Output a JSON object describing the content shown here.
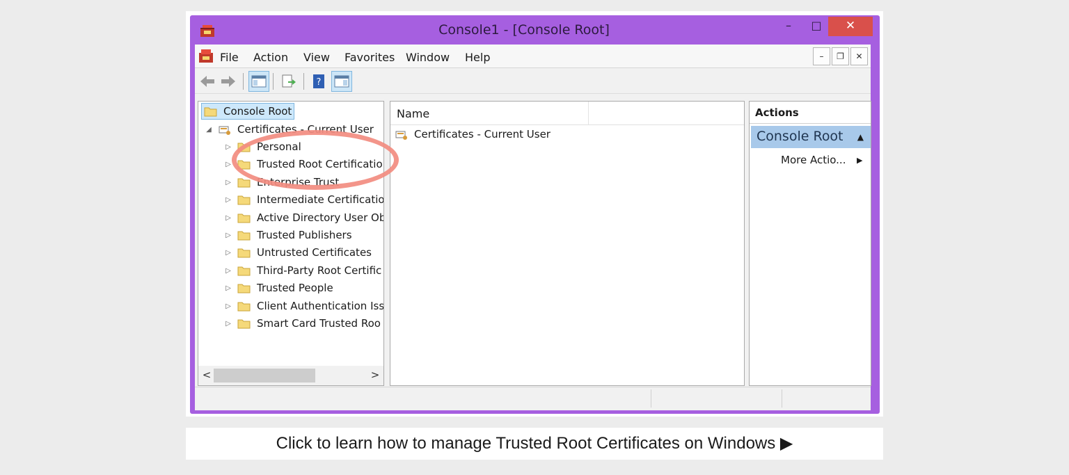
{
  "window": {
    "title": "Console1 - [Console Root]",
    "minimize_glyph": "–",
    "maximize_glyph": "□",
    "close_glyph": "✕",
    "titlebar_color": "#a65fe0",
    "close_color": "#d9504b",
    "app_icon": "mmc-toolbox-icon"
  },
  "menubar": {
    "items": [
      "File",
      "Action",
      "View",
      "Favorites",
      "Window",
      "Help"
    ],
    "mdi": [
      "–",
      "❐",
      "✕"
    ]
  },
  "toolbar": {
    "buttons": [
      "back-arrow-icon",
      "forward-arrow-icon",
      "show-hide-console-tree-icon",
      "export-list-icon",
      "help-icon",
      "show-hide-action-pane-icon"
    ]
  },
  "tree": {
    "root": "Console Root",
    "snapin": "Certificates - Current User",
    "children": [
      "Personal",
      "Trusted Root Certificatio",
      "Enterprise Trust",
      "Intermediate Certificatio",
      "Active Directory User Ob",
      "Trusted Publishers",
      "Untrusted Certificates",
      "Third-Party Root Certific",
      "Trusted People",
      "Client Authentication Iss",
      "Smart Card Trusted Roo"
    ],
    "scroll_left": "<",
    "scroll_right": ">"
  },
  "list": {
    "column_name": "Name",
    "rows": [
      "Certificates - Current User"
    ]
  },
  "actions": {
    "header": "Actions",
    "section": "Console Root",
    "section_caret": "▲",
    "more": "More Actio...",
    "more_arrow": "▶"
  },
  "highlight_color": "#f28c80",
  "caption": "Click to learn how to manage Trusted Root Certificates on Windows ▶"
}
